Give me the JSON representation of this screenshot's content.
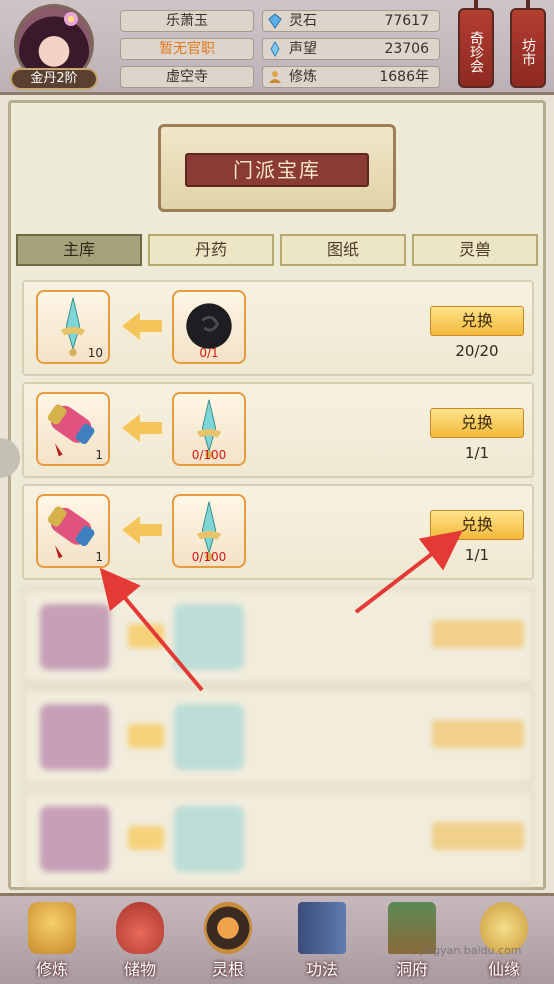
{
  "player": {
    "rank": "金丹2阶",
    "name": "乐萧玉",
    "title": "暂无官职",
    "sect": "虚空寺"
  },
  "stats": [
    {
      "icon": "spirit-stone-icon",
      "label": "灵石",
      "value": "77617"
    },
    {
      "icon": "prestige-icon",
      "label": "声望",
      "value": "23706"
    },
    {
      "icon": "cultivation-icon",
      "label": "修炼",
      "value": "1686年"
    }
  ],
  "top_buttons": {
    "treasure_fair": "奇珍会",
    "market": "坊市"
  },
  "page_title": "门派宝库",
  "tabs": [
    "主库",
    "丹药",
    "图纸",
    "灵兽"
  ],
  "active_tab": "主库",
  "exchange_rows": [
    {
      "reward": {
        "icon": "sword-item-icon",
        "qty": "10"
      },
      "cost": {
        "icon": "black-orb-icon",
        "qty": "0/1"
      },
      "button": "兑换",
      "remaining": "20/20"
    },
    {
      "reward": {
        "icon": "scroll-item-icon",
        "qty": "1"
      },
      "cost": {
        "icon": "sword-item-icon",
        "qty": "0/100"
      },
      "button": "兑换",
      "remaining": "1/1"
    },
    {
      "reward": {
        "icon": "scroll-item-icon",
        "qty": "1"
      },
      "cost": {
        "icon": "sword-item-icon",
        "qty": "0/100"
      },
      "button": "兑换",
      "remaining": "1/1"
    }
  ],
  "bottom_nav": [
    {
      "icon": "cultivate-icon",
      "label": "修炼"
    },
    {
      "icon": "storage-bag-icon",
      "label": "储物"
    },
    {
      "icon": "spirit-root-icon",
      "label": "灵根"
    },
    {
      "icon": "technique-book-icon",
      "label": "功法"
    },
    {
      "icon": "cave-house-icon",
      "label": "洞府"
    },
    {
      "icon": "fortune-icon",
      "label": "仙缘"
    }
  ],
  "watermark": "jingyan.baidu.com",
  "colors": {
    "accent": "#f2b93a",
    "title_banner": "#8a3b33",
    "slot_border": "#e59b3e",
    "annotation_arrow": "#e53935"
  }
}
